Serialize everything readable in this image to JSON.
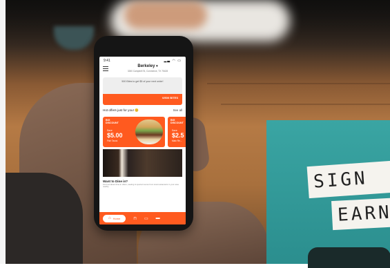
{
  "status_bar": {
    "time": "9:41",
    "icons": "▂▃ ◠ ▭"
  },
  "header": {
    "location": "Berkeley",
    "address": "3260 Campbell St, Commerce, TX 75428"
  },
  "bites_card": {
    "message": "500 Bites to get $5 of your next order!",
    "progress": "0/500 BITES"
  },
  "offers": {
    "section_title": "Hot offers just for you! 😊",
    "see_all": "See all",
    "items": [
      {
        "heading": "BIG\nDISCOUNT",
        "save_label": "Save",
        "price": "$5.00",
        "subtitle": "Fish Tacos"
      },
      {
        "heading": "BIG\nDISCOUNT",
        "save_label": "Save",
        "price": "$2.5",
        "subtitle": "Main Re..."
      }
    ]
  },
  "dine_in": {
    "title": "Want to Dine in?",
    "description": "Find out about dine-in offers, seating & special menus from local restaurants in your area nearby."
  },
  "tab_bar": {
    "home_label": "Home"
  },
  "sign": {
    "line1": "SIGN",
    "line2": "EARN"
  },
  "colors": {
    "accent": "#ff5a1f",
    "teal": "#2f9999"
  }
}
